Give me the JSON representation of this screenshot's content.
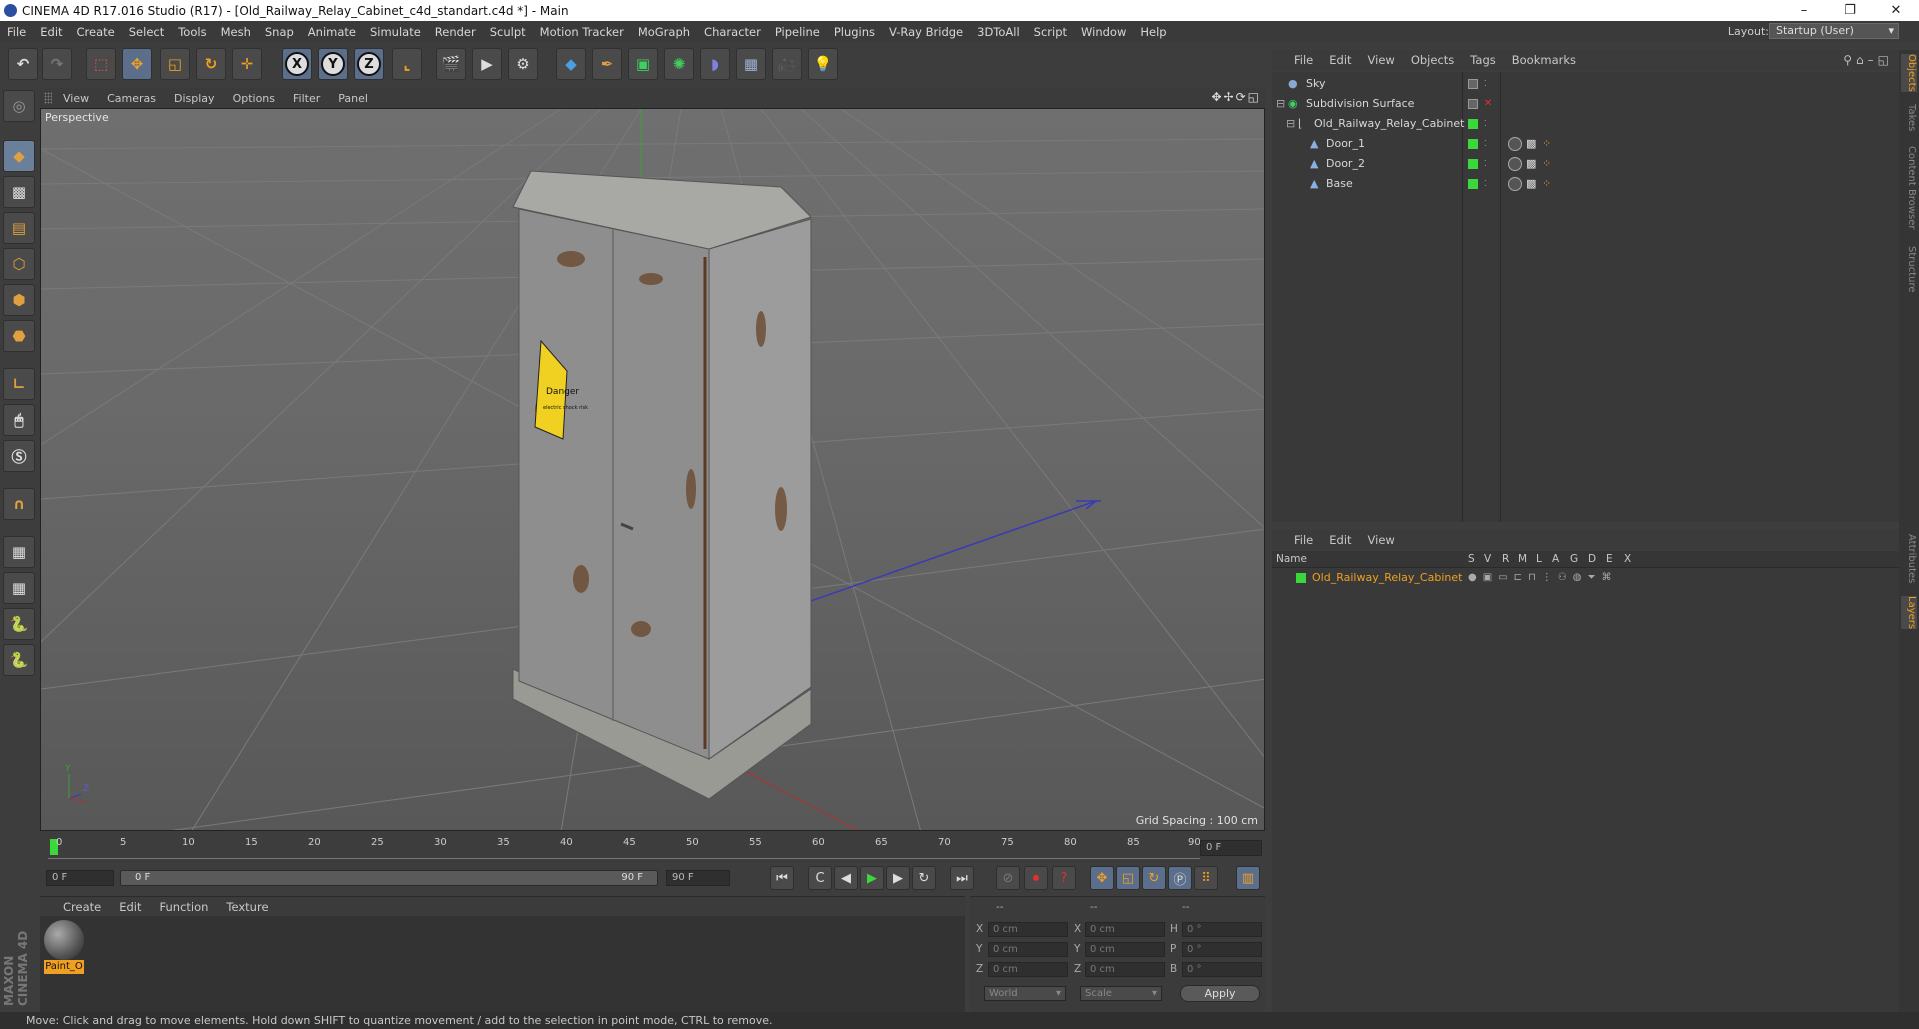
{
  "window": {
    "title": "CINEMA 4D R17.016 Studio (R17) - [Old_Railway_Relay_Cabinet_c4d_standart.c4d *] - Main",
    "minimize": "–",
    "maximize": "❐",
    "close": "✕"
  },
  "menubar": [
    "File",
    "Edit",
    "Create",
    "Select",
    "Tools",
    "Mesh",
    "Snap",
    "Animate",
    "Simulate",
    "Render",
    "Sculpt",
    "Motion Tracker",
    "MoGraph",
    "Character",
    "Pipeline",
    "Plugins",
    "V-Ray Bridge",
    "3DToAll",
    "Script",
    "Window",
    "Help"
  ],
  "layout": {
    "label": "Layout:",
    "value": "Startup (User)"
  },
  "toolbar": {
    "x_label": "X",
    "y_label": "Y",
    "z_label": "Z"
  },
  "viewport": {
    "menu": [
      "View",
      "Cameras",
      "Display",
      "Options",
      "Filter",
      "Panel"
    ],
    "label": "Perspective",
    "grid_spacing": "Grid Spacing : 100 cm",
    "axis_y": "Y",
    "axis_z": "Z",
    "sign_text": "Danger",
    "sign_sub": "electric shock risk"
  },
  "timeline": {
    "ticks": [
      "0",
      "5",
      "10",
      "15",
      "20",
      "25",
      "30",
      "35",
      "40",
      "45",
      "50",
      "55",
      "60",
      "65",
      "70",
      "75",
      "80",
      "85",
      "90"
    ],
    "current_frame": "0 F",
    "start_field": "0 F",
    "range_start": "0 F",
    "range_end": "90 F",
    "end_field": "90 F"
  },
  "material_manager": {
    "menu": [
      "Create",
      "Edit",
      "Function",
      "Texture"
    ],
    "material_name": "Paint_O"
  },
  "coordinates": {
    "header": [
      "--",
      "--",
      "--"
    ],
    "rows": [
      {
        "a": "X",
        "av": "0 cm",
        "b": "X",
        "bv": "0 cm",
        "c": "H",
        "cv": "0 °"
      },
      {
        "a": "Y",
        "av": "0 cm",
        "b": "Y",
        "bv": "0 cm",
        "c": "P",
        "cv": "0 °"
      },
      {
        "a": "Z",
        "av": "0 cm",
        "b": "Z",
        "bv": "0 cm",
        "c": "B",
        "cv": "0 °"
      }
    ],
    "world": "World",
    "scale": "Scale",
    "apply": "Apply"
  },
  "object_manager": {
    "menu": [
      "File",
      "Edit",
      "View",
      "Objects",
      "Tags",
      "Bookmarks"
    ],
    "objects": [
      {
        "name": "Sky",
        "indent": 0
      },
      {
        "name": "Subdivision Surface",
        "indent": 0
      },
      {
        "name": "Old_Railway_Relay_Cabinet",
        "indent": 1
      },
      {
        "name": "Door_1",
        "indent": 2
      },
      {
        "name": "Door_2",
        "indent": 2
      },
      {
        "name": "Base",
        "indent": 2
      }
    ]
  },
  "layer_manager": {
    "menu": [
      "File",
      "Edit",
      "View"
    ],
    "columns": [
      "Name",
      "S",
      "V",
      "R",
      "M",
      "L",
      "A",
      "G",
      "D",
      "E",
      "X"
    ],
    "layer_name": "Old_Railway_Relay_Cabinet"
  },
  "right_tabs": [
    "Objects",
    "Takes",
    "Content Browser",
    "Structure",
    "Attributes",
    "Layers"
  ],
  "brand": "MAXON CINEMA 4D",
  "status": "Move: Click and drag to move elements. Hold down SHIFT to quantize movement / add to the selection in point mode, CTRL to remove.",
  "colors": {
    "accent": "#f0a020",
    "green": "#3ad83a",
    "select_blue": "#5b6f8c"
  }
}
